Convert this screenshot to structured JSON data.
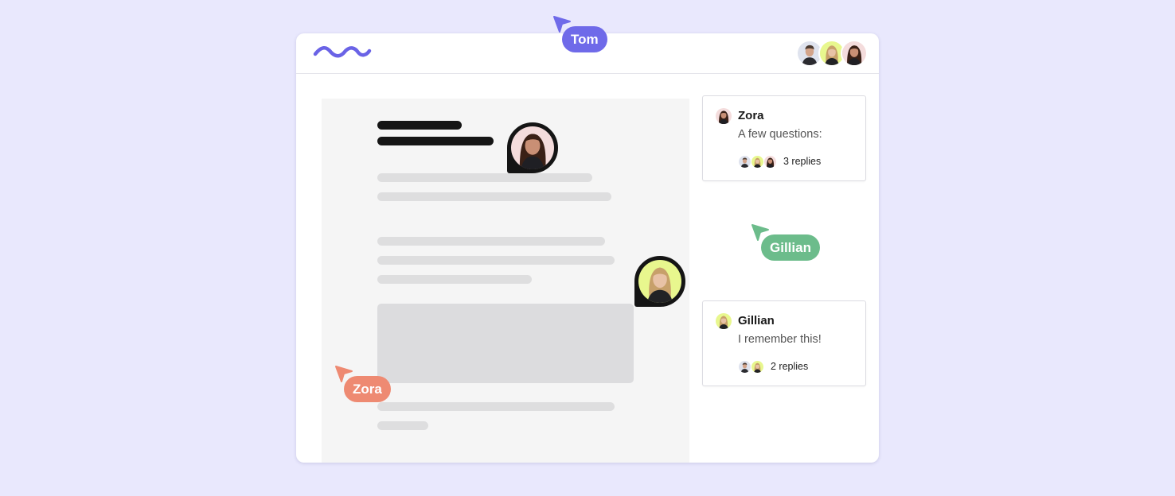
{
  "colors": {
    "background": "#e9e8fd",
    "brand": "#6a63e6",
    "tom_cursor": "#6f6ae9",
    "gillian_cursor": "#6cbc8b",
    "zora_cursor": "#ee8a72",
    "gillian_avatar_bg": "#e8f78e"
  },
  "header": {
    "logo_icon": "wave-logo-icon",
    "presence_avatars": [
      "tom-avatar",
      "gillian-avatar",
      "zora-avatar"
    ]
  },
  "cursors": {
    "tom": "Tom",
    "gillian": "Gillian",
    "zora": "Zora"
  },
  "comments": [
    {
      "author": "Zora",
      "message": "A few questions:",
      "replies_label": "3 replies"
    },
    {
      "author": "Gillian",
      "message": "I remember this!",
      "replies_label": "2 replies"
    }
  ]
}
